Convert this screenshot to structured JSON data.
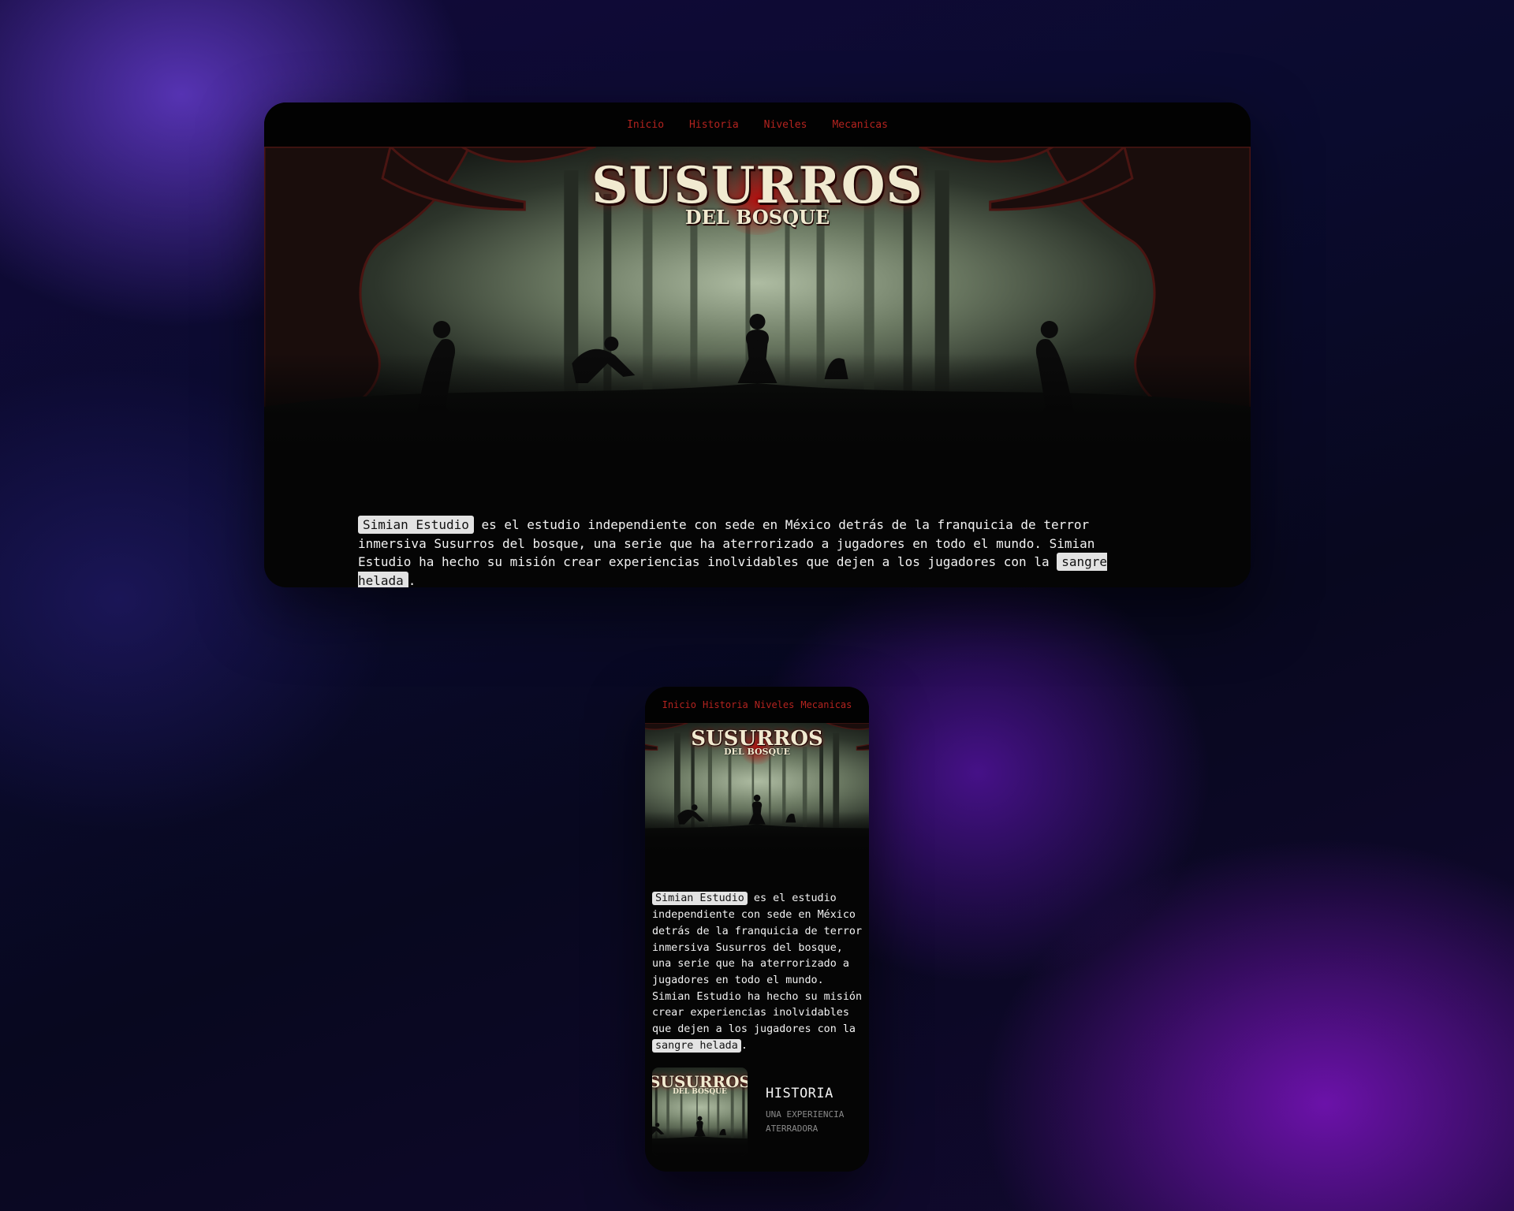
{
  "nav": {
    "items": [
      {
        "label": "Inicio"
      },
      {
        "label": "Historia"
      },
      {
        "label": "Niveles"
      },
      {
        "label": "Mecanicas"
      }
    ]
  },
  "hero": {
    "logo_main": "SUSURROS",
    "logo_sub": "DEL BOSQUE"
  },
  "intro": {
    "studio": "Simian Estudio",
    "body": " es el estudio independiente con sede en México detrás de la franquicia de terror inmersiva Susurros del bosque, una serie que ha aterrorizado a jugadores en todo el mundo. Simian Estudio ha hecho su misión crear experiencias inolvidables que dejen a los jugadores con la ",
    "highlight": "sangre helada",
    "end": "."
  },
  "card": {
    "title": "HISTORIA",
    "subtitle": "UNA EXPERIENCIA ATERRADORA"
  },
  "colors": {
    "nav_link": "#b3231f",
    "page_bg": "#050505",
    "highlight_bg": "#e3e3e3"
  }
}
